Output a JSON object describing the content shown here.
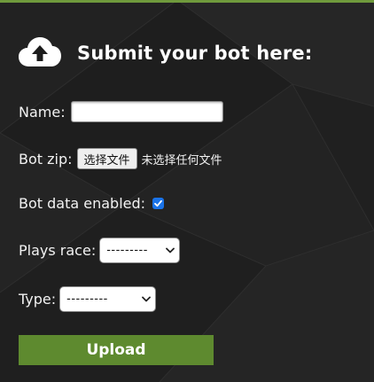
{
  "header": {
    "title": "Submit your bot here:",
    "icon": "cloud-upload-icon"
  },
  "form": {
    "name": {
      "label": "Name:",
      "value": ""
    },
    "bot_zip": {
      "label": "Bot zip:",
      "button_label": "选择文件",
      "status": "未选择任何文件"
    },
    "bot_data": {
      "label": "Bot data enabled:",
      "checked": true
    },
    "race": {
      "label": "Plays race:",
      "selected": "---------"
    },
    "type": {
      "label": "Type:",
      "selected": "---------"
    },
    "submit_label": "Upload"
  },
  "colors": {
    "background": "#1c1c1c",
    "accent_line": "#6f9a3c",
    "button": "#5e8a2f",
    "checkbox": "#1a73e8"
  }
}
